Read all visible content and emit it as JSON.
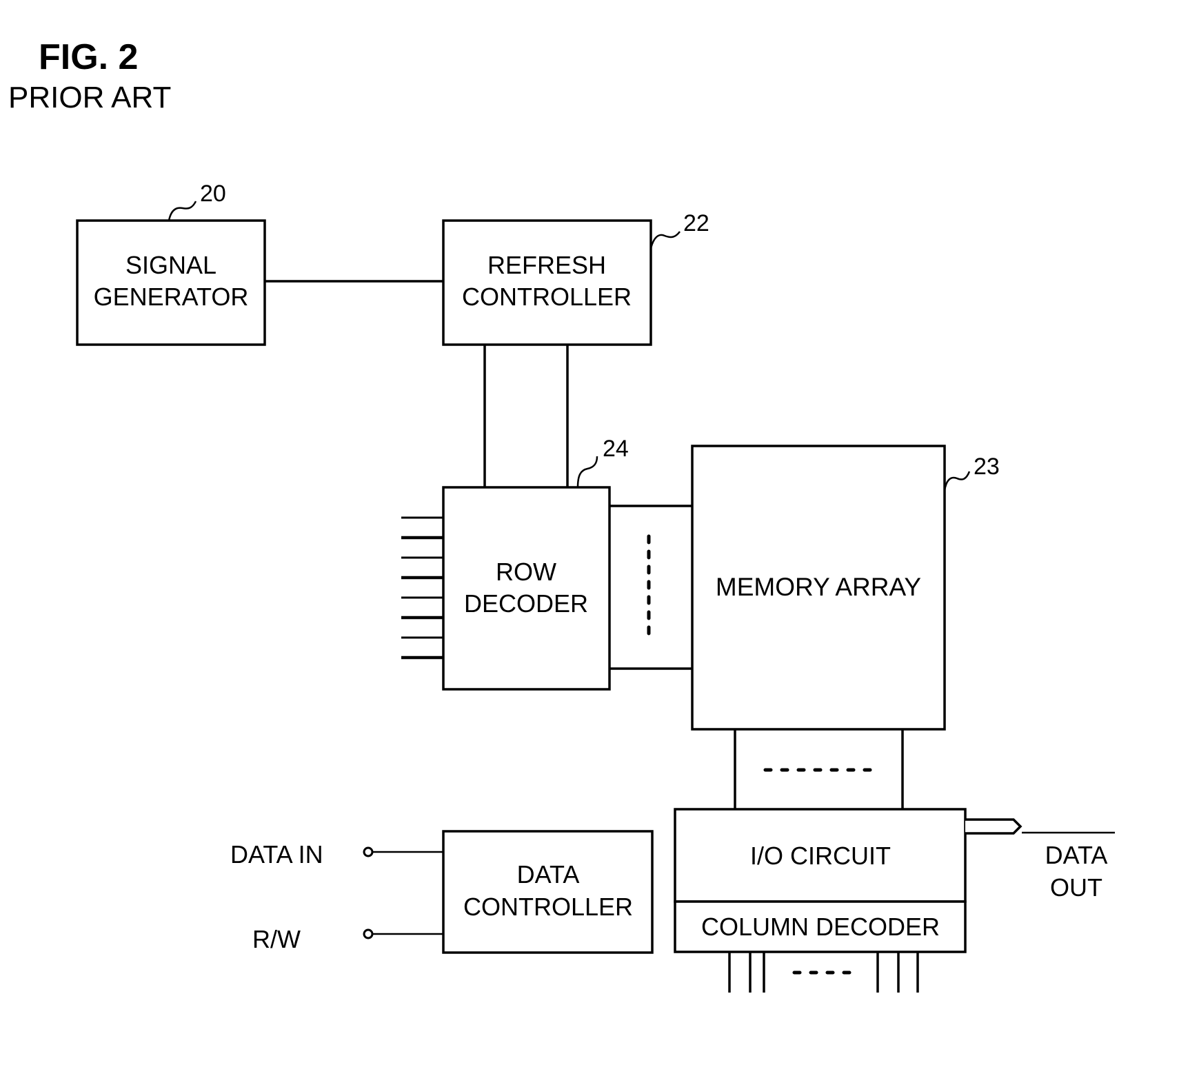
{
  "figure": {
    "title": "FIG. 2",
    "subtitle": "PRIOR ART"
  },
  "blocks": {
    "signal_generator": {
      "ref": "20",
      "lines": [
        "SIGNAL",
        "GENERATOR"
      ]
    },
    "refresh_controller": {
      "ref": "22",
      "lines": [
        "REFRESH",
        "CONTROLLER"
      ]
    },
    "row_decoder": {
      "ref": "24",
      "lines": [
        "ROW",
        "DECODER"
      ]
    },
    "memory_array": {
      "ref": "23",
      "lines": [
        "MEMORY ARRAY"
      ]
    },
    "data_controller": {
      "lines": [
        "DATA",
        "CONTROLLER"
      ]
    },
    "io_circuit": {
      "lines": [
        "I/O CIRCUIT"
      ]
    },
    "column_decoder": {
      "lines": [
        "COLUMN DECODER"
      ]
    }
  },
  "terminals": {
    "data_in": "DATA IN",
    "rw": "R/W",
    "data_out": [
      "DATA",
      "OUT"
    ]
  },
  "row_decoder_input_lines": 8,
  "column_decoder_output_lines": {
    "left_group": 3,
    "right_group": 3
  }
}
